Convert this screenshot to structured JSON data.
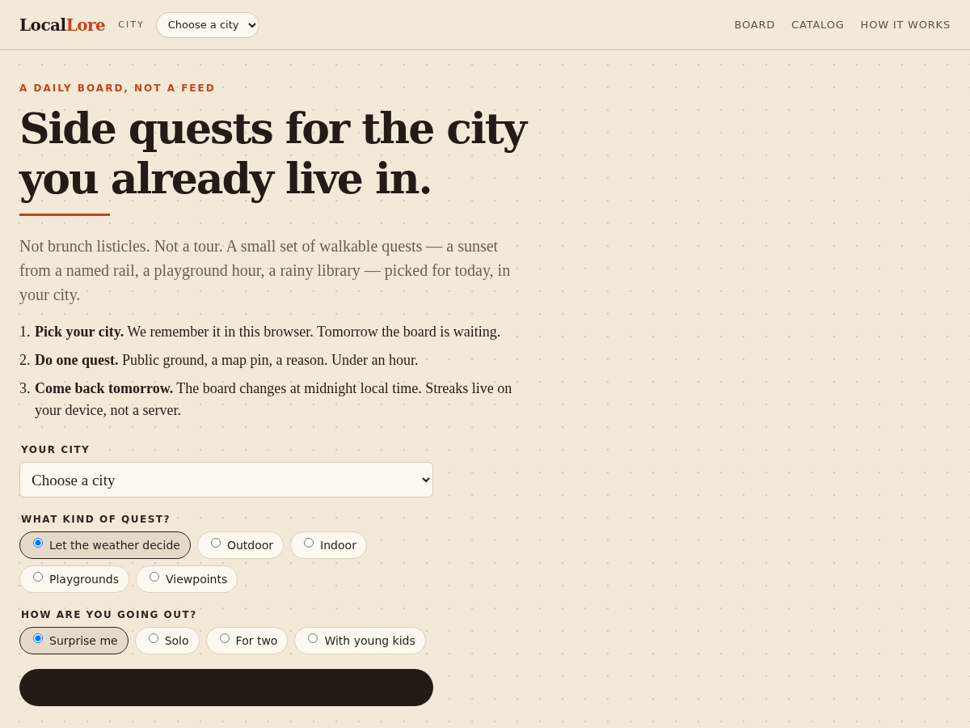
{
  "header": {
    "logo": {
      "first": "Local",
      "second": "Lore"
    },
    "city_label": "CITY",
    "city_select": {
      "value": "Choose a city"
    },
    "nav": [
      {
        "label": "BOARD"
      },
      {
        "label": "CATALOG"
      },
      {
        "label": "HOW IT WORKS"
      }
    ]
  },
  "hero": {
    "eyebrow": "A DAILY BOARD, NOT A FEED",
    "title_lines": [
      "Side quests for the city",
      "you already live in."
    ],
    "intro": "Not brunch listicles. Not a tour. A small set of walkable quests — a sunset from a named rail, a playground hour, a rainy library — picked for today, in your city.",
    "steps": [
      {
        "number": "1.",
        "text": "**Pick your city.** We remember it in this browser. Tomorrow the board is waiting."
      },
      {
        "number": "2.",
        "text": "**Do one quest.** Public ground, a map pin, a reason. Under an hour."
      },
      {
        "number": "3.",
        "text": "**Come back tomorrow.** The board changes at midnight local time. Streaks live on your device, not a server."
      }
    ]
  },
  "form": {
    "city": {
      "label": "YOUR CITY",
      "value": "Choose a city"
    },
    "groups": [
      {
        "label": "WHAT KIND OF QUEST?",
        "options": [
          {
            "label": "Let the weather decide",
            "selected": true
          },
          {
            "label": "Outdoor",
            "selected": false
          },
          {
            "label": "Indoor",
            "selected": false
          },
          {
            "label": "Playgrounds",
            "selected": false
          },
          {
            "label": "Viewpoints",
            "selected": false
          }
        ]
      },
      {
        "label": "HOW ARE YOU GOING OUT?",
        "options": [
          {
            "label": "Surprise me",
            "selected": true
          },
          {
            "label": "Solo",
            "selected": false
          },
          {
            "label": "For two",
            "selected": false
          },
          {
            "label": "With young kids",
            "selected": false
          }
        ]
      }
    ]
  }
}
